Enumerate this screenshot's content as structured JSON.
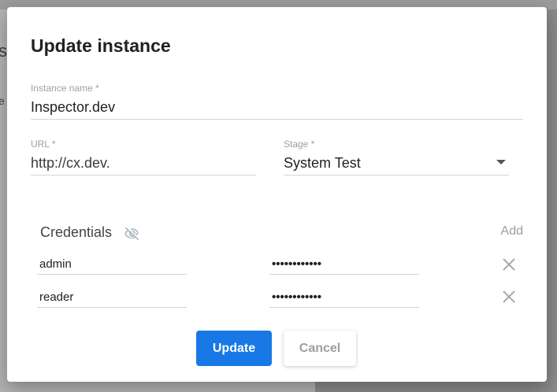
{
  "background": {
    "fragment_sp": "sp",
    "fragment_e": "e"
  },
  "dialog": {
    "title": "Update instance",
    "instance_name": {
      "label": "Instance name *",
      "value": "Inspector.dev"
    },
    "url": {
      "label": "URL *",
      "value": "http://cx.dev."
    },
    "stage": {
      "label": "Stage *",
      "value": "System Test"
    },
    "credentials": {
      "title": "Credentials",
      "add_label": "Add",
      "rows": [
        {
          "username": "admin",
          "password": "••••••••••••"
        },
        {
          "username": "reader",
          "password": "••••••••••••"
        }
      ]
    },
    "buttons": {
      "update": "Update",
      "cancel": "Cancel"
    }
  },
  "colors": {
    "primary": "#1778e6",
    "muted": "#9e9e9e",
    "icon": "#b0bec5"
  }
}
